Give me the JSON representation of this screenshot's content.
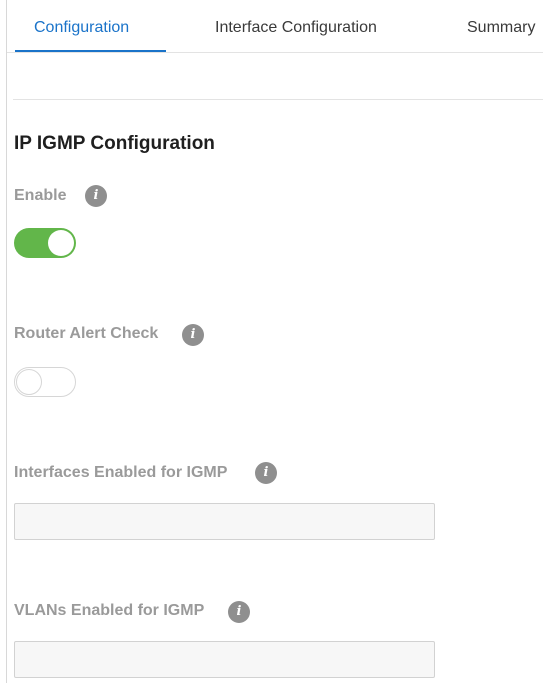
{
  "tabs": [
    {
      "label": "Configuration",
      "active": true
    },
    {
      "label": "Interface Configuration",
      "active": false
    },
    {
      "label": "Summary",
      "active": false
    }
  ],
  "section": {
    "title": "IP IGMP Configuration"
  },
  "fields": {
    "enable": {
      "label": "Enable",
      "state": "on"
    },
    "router_alert_check": {
      "label": "Router Alert Check",
      "state": "off"
    },
    "interfaces_enabled": {
      "label": "Interfaces Enabled for IGMP",
      "value": "",
      "placeholder": ""
    },
    "vlans_enabled": {
      "label": "VLANs Enabled for IGMP",
      "value": "",
      "placeholder": ""
    }
  },
  "colors": {
    "accent": "#1a73c9",
    "toggle_on": "#62b64a",
    "info_icon": "#8f8f8f"
  },
  "icons": {
    "info": "i"
  }
}
